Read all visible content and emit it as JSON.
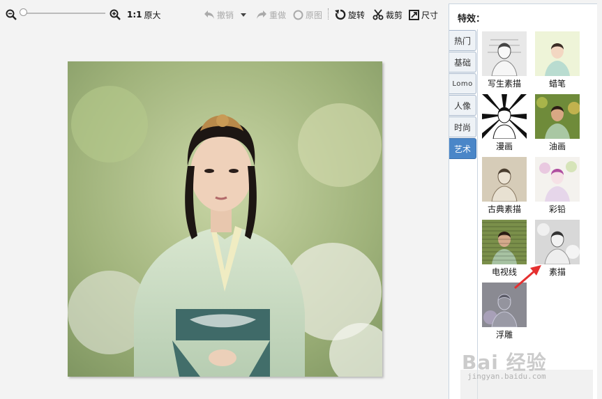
{
  "toolbar": {
    "ratio_label": "1:1",
    "original_size_label": "原大",
    "undo_label": "撤销",
    "redo_label": "重做",
    "original_image_label": "原图",
    "rotate_label": "旋转",
    "crop_label": "裁剪",
    "size_label": "尺寸",
    "zoom_level": 0.0
  },
  "panel": {
    "title": "特效：",
    "tabs": [
      {
        "label": "热门"
      },
      {
        "label": "基础"
      },
      {
        "label": "Lomo"
      },
      {
        "label": "人像"
      },
      {
        "label": "时尚"
      },
      {
        "label": "艺术",
        "active": true
      }
    ],
    "effects": [
      {
        "label": "写生素描",
        "icon": "sketch-thumbnail"
      },
      {
        "label": "蜡笔",
        "icon": "crayon-thumbnail"
      },
      {
        "label": "漫画",
        "icon": "comic-thumbnail"
      },
      {
        "label": "油画",
        "icon": "oil-painting-thumbnail"
      },
      {
        "label": "古典素描",
        "icon": "classic-sketch-thumbnail"
      },
      {
        "label": "彩铅",
        "icon": "colored-pencil-thumbnail"
      },
      {
        "label": "电视线",
        "icon": "tv-lines-thumbnail"
      },
      {
        "label": "素描",
        "icon": "pencil-sketch-thumbnail"
      },
      {
        "label": "浮雕",
        "icon": "emboss-thumbnail"
      }
    ]
  },
  "watermark": {
    "brand": "Bai  经验",
    "url": "jingyan.baidu.com"
  },
  "colors": {
    "accent": "#4a86c8",
    "arrow": "#e53030"
  }
}
